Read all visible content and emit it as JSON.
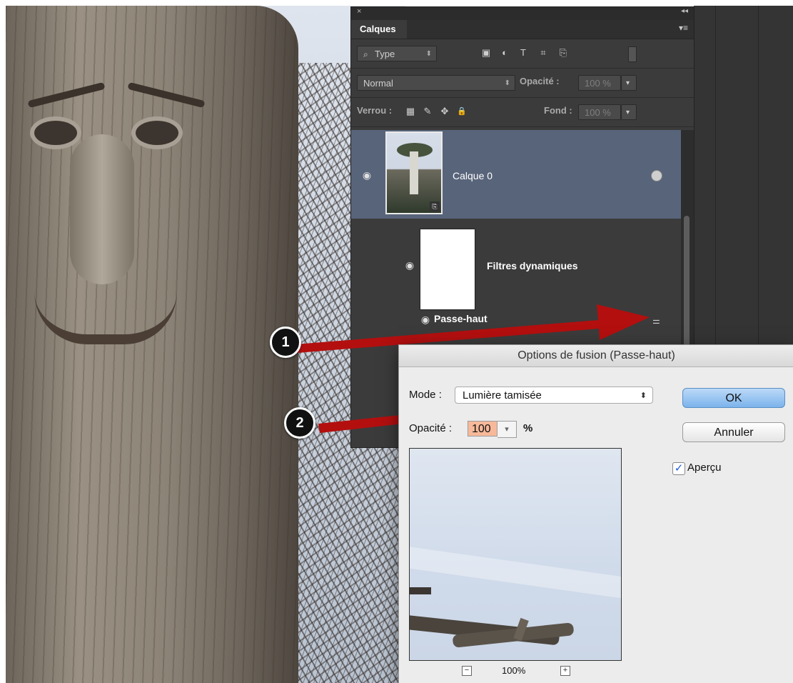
{
  "layers_panel": {
    "close_glyph": "×",
    "collapse_glyph": "◂◂",
    "tab_label": "Calques",
    "panel_menu_glyph": "▾≡",
    "filter_kind": "Type",
    "filter_search_glyph": "⌕",
    "filter_chevron": "⬍",
    "filter_icons": [
      "image-icon",
      "adjustment-icon",
      "type-icon",
      "shape-icon",
      "smart-object-icon"
    ],
    "filter_glyphs": [
      "▣",
      "◐",
      "T",
      "⌗",
      "⎘"
    ],
    "blend_mode": "Normal",
    "opacity_label": "Opacité :",
    "opacity_value": "100 %",
    "lock_label": "Verrou :",
    "lock_glyphs": [
      "▦",
      "✎",
      "✥",
      "🔒"
    ],
    "fill_label": "Fond :",
    "fill_value": "100 %",
    "dropdown_chevron": "▾",
    "layers": [
      {
        "name": "Calque 0",
        "visible": true,
        "selected": true
      },
      {
        "name": "Filtres dynamiques",
        "visible": true,
        "selected": false
      },
      {
        "name": "Passe-haut",
        "visible": true,
        "selected": false
      }
    ],
    "eye_glyph": "◉",
    "filter_adjust_glyph": "⚌"
  },
  "annotations": {
    "callout_1": "1",
    "callout_2": "2",
    "arrow_color": "#b30f0f"
  },
  "dialog": {
    "title": "Options de fusion (Passe-haut)",
    "mode_label": "Mode :",
    "mode_value": "Lumière tamisée",
    "mode_arrows": "⬍",
    "opacity_label": "Opacité :",
    "opacity_value": "100",
    "opacity_dropdown": "▾",
    "opacity_unit": "%",
    "ok_label": "OK",
    "cancel_label": "Annuler",
    "preview_label": "Aperçu",
    "preview_checked": true,
    "check_glyph": "✓",
    "zoom_out_glyph": "−",
    "zoom_in_glyph": "+",
    "zoom_level": "100%"
  },
  "colors": {
    "panel_bg": "#3b3b3b",
    "selected_layer_bg": "#58647a",
    "ok_button": "#7bb3ec",
    "opacity_field_highlight": "#f7b99a"
  }
}
